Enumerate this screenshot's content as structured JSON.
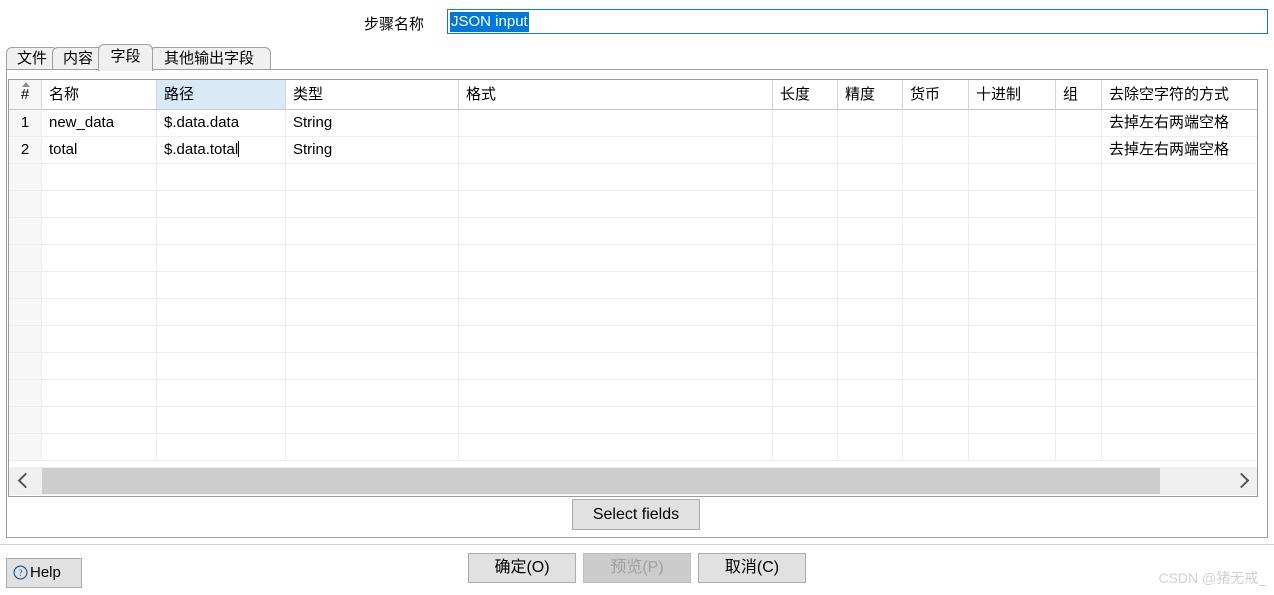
{
  "step_name": {
    "label": "步骤名称",
    "value": "JSON input"
  },
  "tabs": [
    {
      "id": "wenjian",
      "label": "文件",
      "selected": false
    },
    {
      "id": "neirong",
      "label": "内容",
      "selected": false
    },
    {
      "id": "ziduan",
      "label": "字段",
      "selected": true
    },
    {
      "id": "qita",
      "label": "其他输出字段",
      "selected": false
    }
  ],
  "table": {
    "sort_indicator": "caret-up",
    "highlight_column_index": 2,
    "columns": [
      {
        "key": "num",
        "label": "#"
      },
      {
        "key": "name",
        "label": "名称"
      },
      {
        "key": "path",
        "label": "路径"
      },
      {
        "key": "type",
        "label": "类型"
      },
      {
        "key": "format",
        "label": "格式"
      },
      {
        "key": "length",
        "label": "长度"
      },
      {
        "key": "precision",
        "label": "精度"
      },
      {
        "key": "currency",
        "label": "货币"
      },
      {
        "key": "decimal",
        "label": "十进制"
      },
      {
        "key": "group",
        "label": "组"
      },
      {
        "key": "trim",
        "label": "去除空字符的方式"
      }
    ],
    "rows": [
      {
        "num": "1",
        "name": "new_data",
        "path": "$.data.data",
        "type": "String",
        "format": "",
        "length": "",
        "precision": "",
        "currency": "",
        "decimal": "",
        "group": "",
        "trim": "去掉左右两端空格"
      },
      {
        "num": "2",
        "name": "total",
        "path": "$.data.total",
        "type": "String",
        "format": "",
        "length": "",
        "precision": "",
        "currency": "",
        "decimal": "",
        "group": "",
        "trim": "去掉左右两端空格"
      }
    ],
    "empty_row_count": 11
  },
  "scrollbar": {
    "left_arrow": "chevron-left-icon",
    "right_arrow": "chevron-right-icon"
  },
  "buttons": {
    "select_fields": "Select fields",
    "help": "Help",
    "help_icon": "question-circle-icon",
    "ok": "确定(O)",
    "preview": "预览(P)",
    "preview_disabled": true,
    "cancel": "取消(C)"
  },
  "watermark": "CSDN @猪无戒_",
  "colors": {
    "selection_blue": "#0078d7",
    "focus_border": "#1878c8",
    "column_highlight": "#d9e9f7",
    "button_face": "#e1e1e1",
    "disabled_face": "#cccccc"
  }
}
